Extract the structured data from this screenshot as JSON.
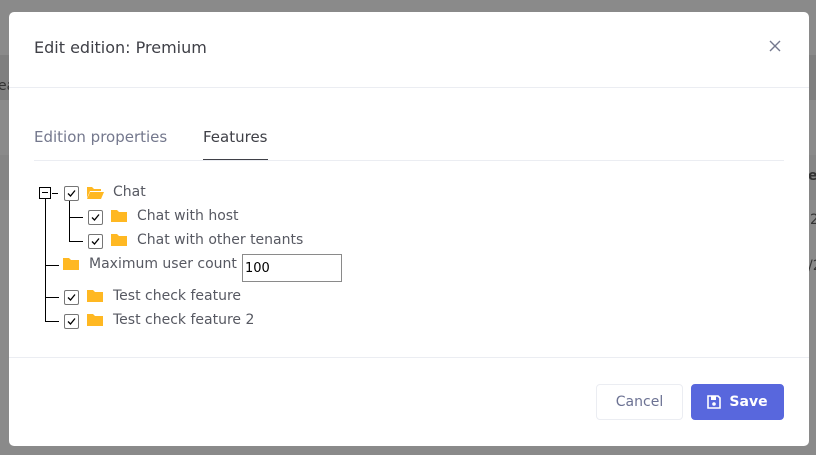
{
  "background": {
    "fragments": [
      "ea",
      "ea",
      "2",
      "/2"
    ]
  },
  "modal": {
    "title": "Edit edition: Premium",
    "close_icon": "close-icon"
  },
  "tabs": [
    {
      "label": "Edition properties",
      "active": false
    },
    {
      "label": "Features",
      "active": true
    }
  ],
  "tree": {
    "nodes": [
      {
        "label": "Chat",
        "checked": true,
        "icon": "folder-open-icon",
        "expanded": true
      },
      {
        "label": "Chat with host",
        "checked": true,
        "icon": "folder-icon"
      },
      {
        "label": "Chat with other tenants",
        "checked": true,
        "icon": "folder-icon"
      },
      {
        "label": "Maximum user count",
        "icon": "folder-icon",
        "value": "100"
      },
      {
        "label": "Test check feature",
        "checked": true,
        "icon": "folder-icon"
      },
      {
        "label": "Test check feature 2",
        "checked": true,
        "icon": "folder-icon"
      }
    ]
  },
  "footer": {
    "cancel_label": "Cancel",
    "save_label": "Save",
    "save_icon": "save-icon"
  },
  "colors": {
    "primary": "#5867dd",
    "folder": "#ffb822"
  }
}
